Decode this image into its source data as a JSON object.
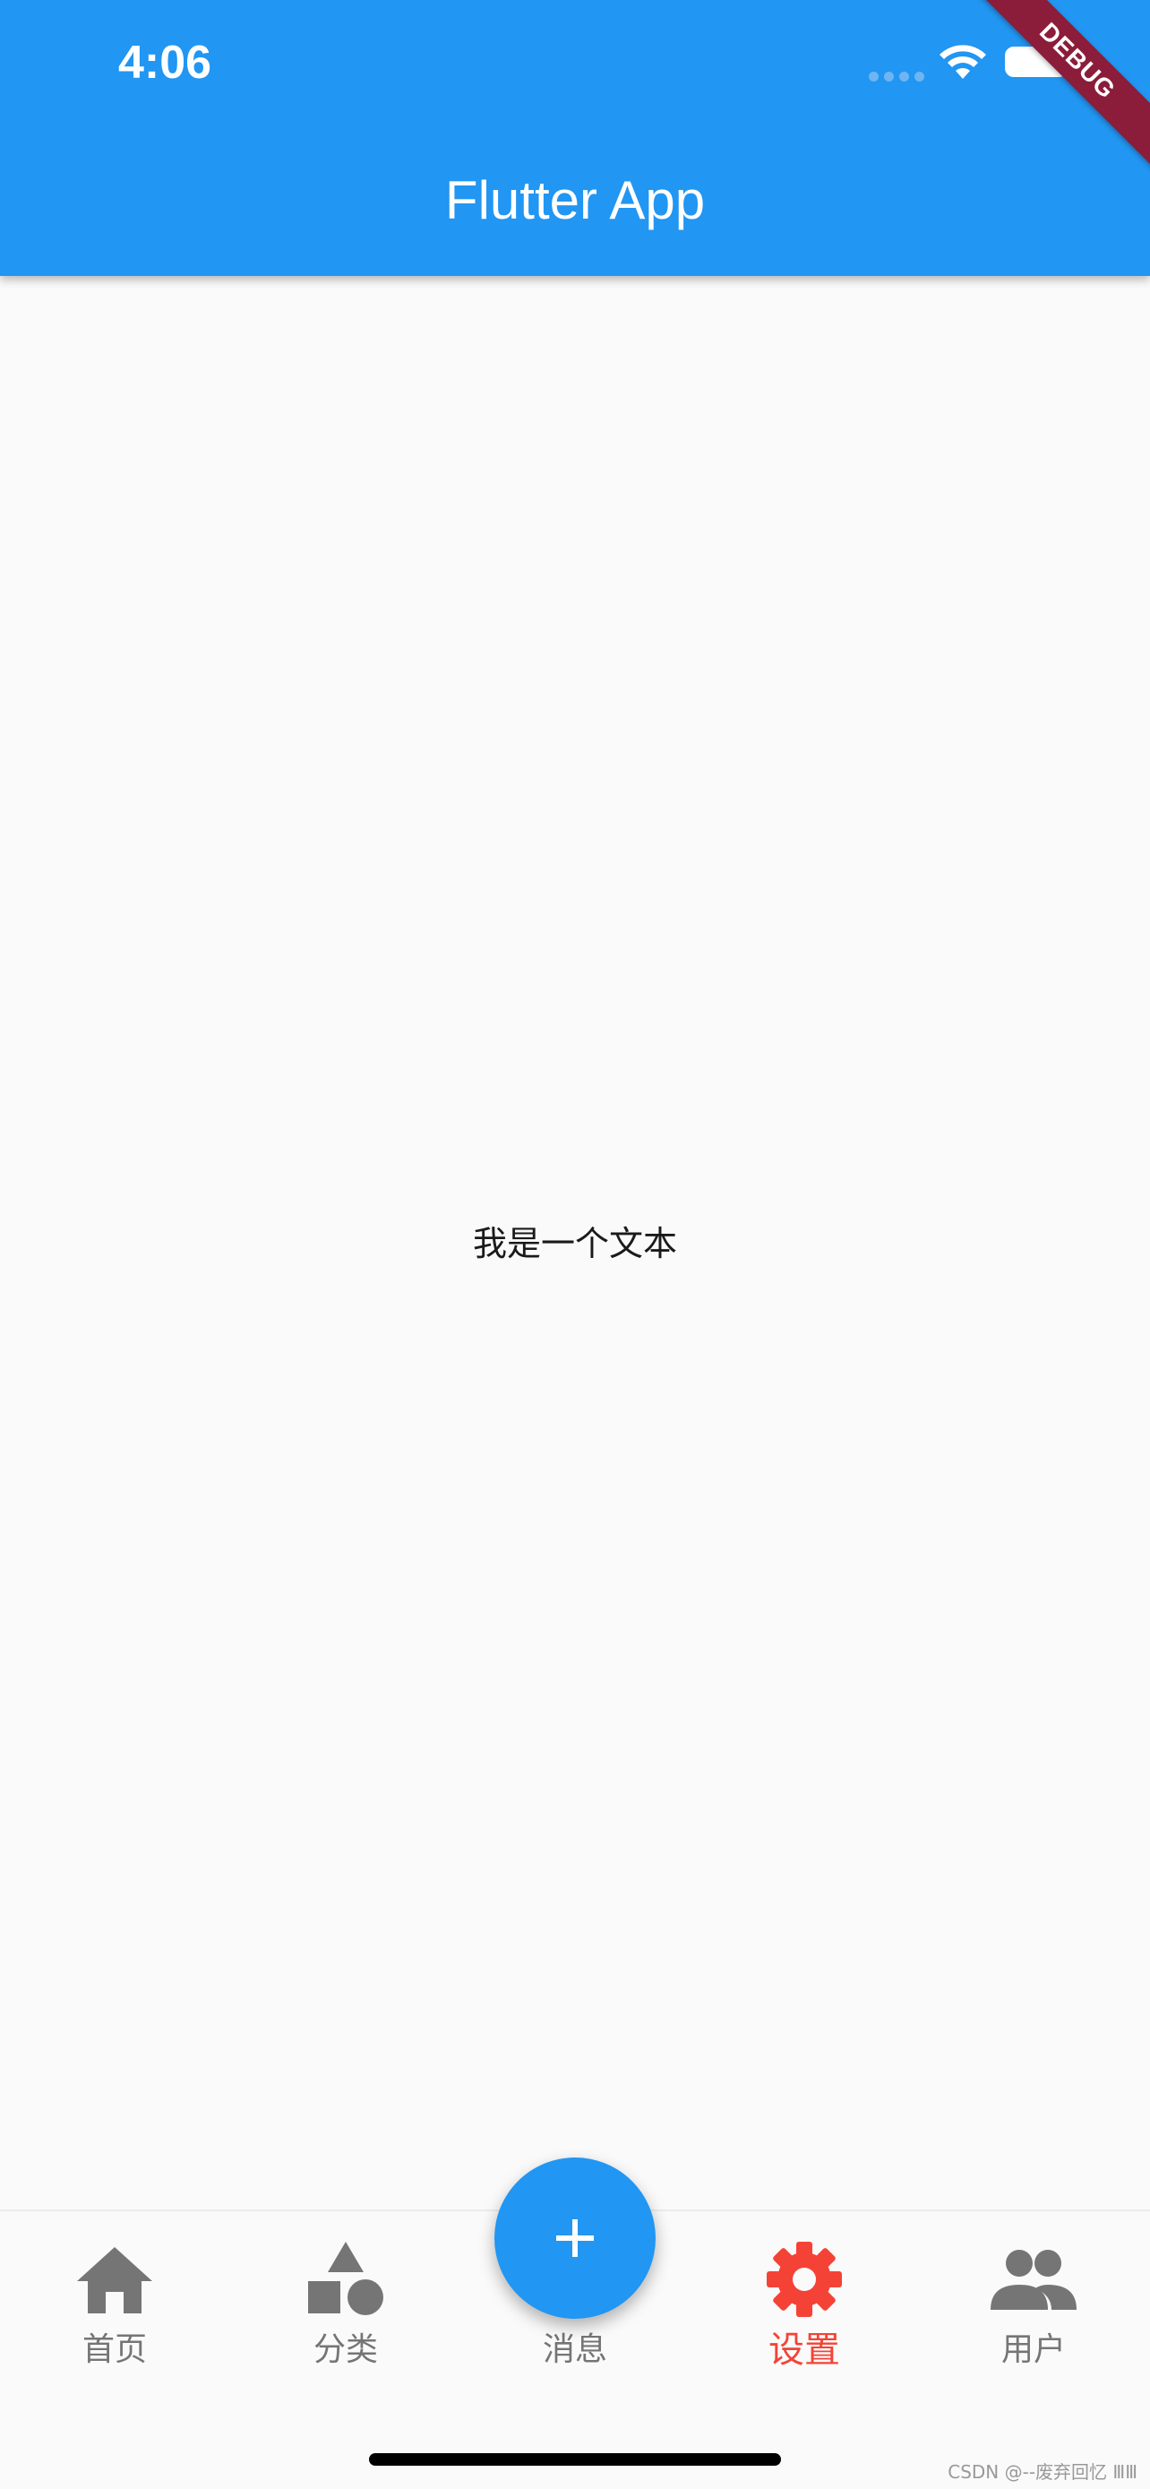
{
  "status_bar": {
    "time": "4:06"
  },
  "app_bar": {
    "title": "Flutter App",
    "debug_banner": "DEBUG",
    "color": "#2196f3"
  },
  "body": {
    "text": "我是一个文本"
  },
  "bottom_nav": {
    "active_index": 3,
    "active_color": "#f44336",
    "inactive_color": "#757575",
    "items": [
      {
        "label": "首页",
        "icon": "home-icon"
      },
      {
        "label": "分类",
        "icon": "category-icon"
      },
      {
        "label": "消息",
        "icon": "message-icon"
      },
      {
        "label": "设置",
        "icon": "settings-icon"
      },
      {
        "label": "用户",
        "icon": "people-icon"
      }
    ]
  },
  "fab": {
    "icon": "add-icon"
  },
  "watermark": "CSDN @--废弃回忆 ⅢⅢ"
}
